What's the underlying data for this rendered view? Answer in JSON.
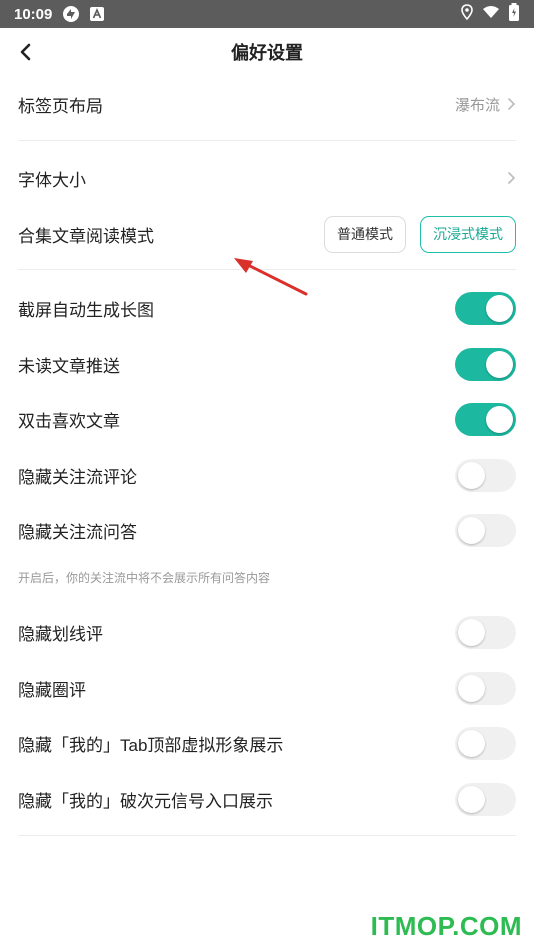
{
  "status_bar": {
    "time": "10:09"
  },
  "header": {
    "title": "偏好设置"
  },
  "section1": {
    "tab_layout_label": "标签页布局",
    "tab_layout_value": "瀑布流"
  },
  "section2": {
    "font_size_label": "字体大小",
    "collection_mode_label": "合集文章阅读模式",
    "mode_normal": "普通模式",
    "mode_immersive": "沉浸式模式",
    "selected_mode": "沉浸式模式"
  },
  "toggles": [
    {
      "label": "截屏自动生成长图",
      "on": true
    },
    {
      "label": "未读文章推送",
      "on": true
    },
    {
      "label": "双击喜欢文章",
      "on": true
    },
    {
      "label": "隐藏关注流评论",
      "on": false
    },
    {
      "label": "隐藏关注流问答",
      "on": false
    }
  ],
  "hint": "开启后，你的关注流中将不会展示所有问答内容",
  "toggles2": [
    {
      "label": "隐藏划线评",
      "on": false
    },
    {
      "label": "隐藏圈评",
      "on": false
    },
    {
      "label": "隐藏「我的」Tab顶部虚拟形象展示",
      "on": false
    },
    {
      "label": "隐藏「我的」破次元信号入口展示",
      "on": false
    }
  ],
  "watermark": "ITMOP.COM",
  "colors": {
    "accent": "#1cb8a0",
    "status_bar": "#5c5c5c",
    "annotation_arrow": "#d9302c",
    "watermark": "#2dbb52"
  }
}
